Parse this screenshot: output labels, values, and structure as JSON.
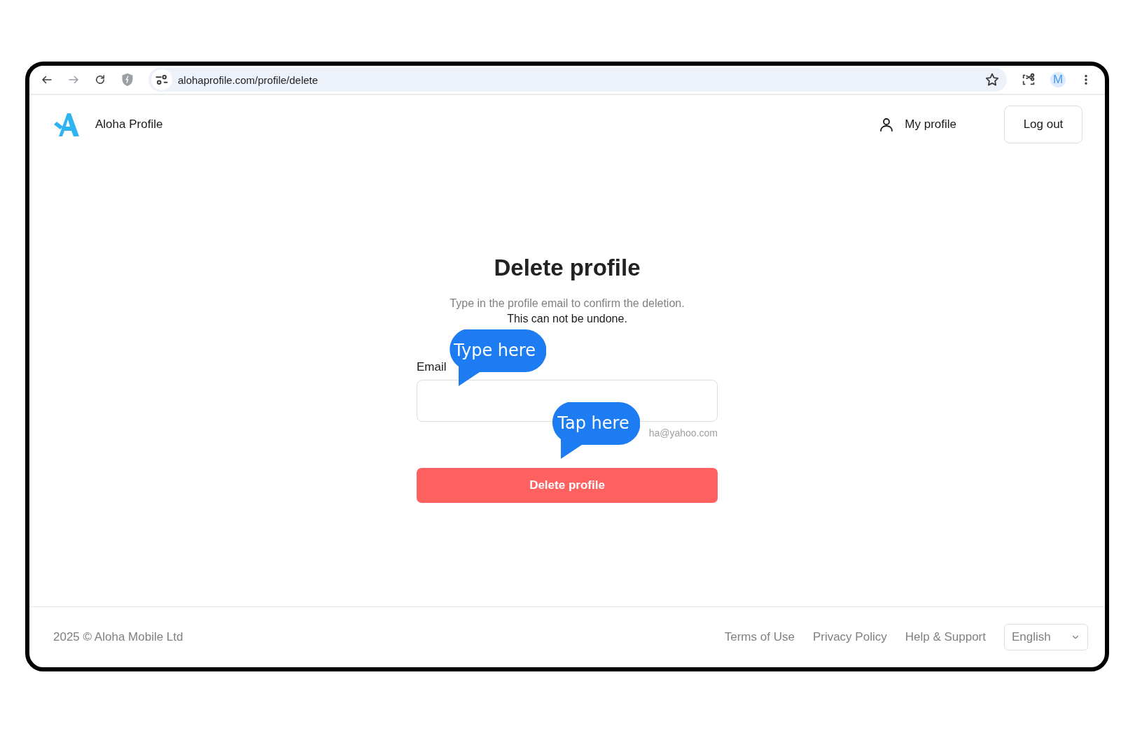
{
  "browser": {
    "url": "alohaprofile.com/profile/delete",
    "account_initial": "M",
    "forward_disabled": true
  },
  "header": {
    "brand": "Aloha Profile",
    "profile_link": "My profile",
    "logout": "Log out"
  },
  "main": {
    "title": "Delete profile",
    "description": "Type in the profile email to confirm the deletion.",
    "warning": "This can not be undone.",
    "field_label": "Email",
    "field_hint": "ha@yahoo.com",
    "submit": "Delete profile"
  },
  "callouts": [
    {
      "text": "Type here",
      "kind": "upper"
    },
    {
      "text": "Tap here",
      "kind": "lower"
    }
  ],
  "footer": {
    "copyright": "2025 © Aloha Mobile Ltd",
    "links": [
      "Terms of Use",
      "Privacy Policy",
      "Help & Support"
    ],
    "language": "English"
  }
}
